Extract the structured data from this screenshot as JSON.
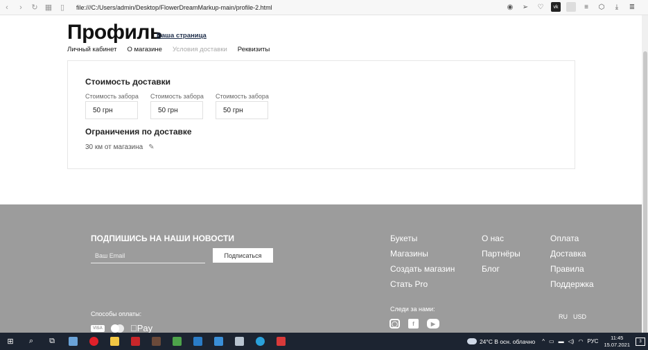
{
  "browser": {
    "url": "file:///C:/Users/admin/Desktop/FlowerDreamMarkup-main/profile-2.html"
  },
  "header": {
    "title": "Профиль",
    "your_page_link": "Ваша страница"
  },
  "tabs": [
    {
      "label": "Личный кабинет",
      "active": false
    },
    {
      "label": "О магазине",
      "active": false
    },
    {
      "label": "Условия доставки",
      "active": true
    },
    {
      "label": "Реквизиты",
      "active": false
    }
  ],
  "delivery": {
    "cost_title": "Стоимость доставки",
    "fields": [
      {
        "label": "Стоимость забора",
        "value": "50 грн"
      },
      {
        "label": "Стоимость забора",
        "value": "50 грн"
      },
      {
        "label": "Стоимость забора",
        "value": "50 грн"
      }
    ],
    "limits_title": "Ограничения по доставке",
    "limit_value": "30 км от магазина"
  },
  "footer": {
    "subscribe_title": "ПОДПИШИСЬ НА НАШИ НОВОСТИ",
    "email_placeholder": "Ваш Email",
    "subscribe_button": "Подписаться",
    "payment_label": "Способы оплаты:",
    "payment_visa": "VISA",
    "payment_apple": "Pay",
    "links_col1": [
      "Букеты",
      "Магазины",
      "Создать магазин",
      "Стать Pro"
    ],
    "links_col2": [
      "О нас",
      "Партнёры",
      "Блог"
    ],
    "links_col3": [
      "Оплата",
      "Доставка",
      "Правила",
      "Поддержка"
    ],
    "follow_label": "Следи за нами:",
    "lang": "RU",
    "currency": "USD"
  },
  "taskbar": {
    "weather": "24°C  В осн. облачно",
    "language": "РУС",
    "time": "11:45",
    "date": "15.07.2021",
    "notifications": "3"
  }
}
